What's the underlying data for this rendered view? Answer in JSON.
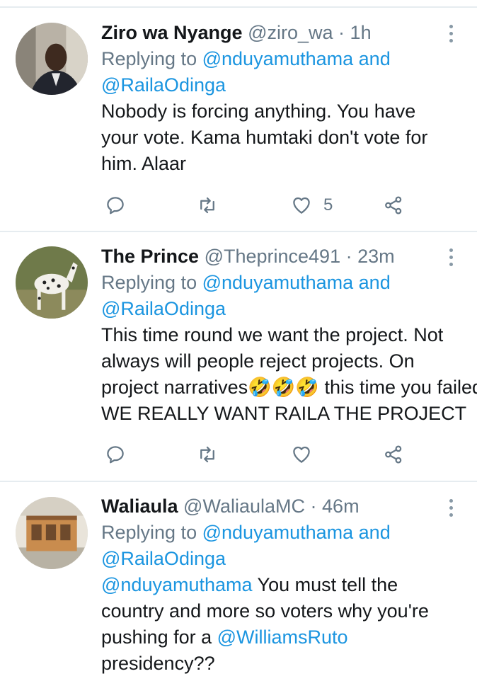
{
  "tweets": [
    {
      "name": "Ziro wa Nyange",
      "handle": "@ziro_wa",
      "dot": "·",
      "time": "1h",
      "replying_prefix": "Replying to",
      "replying_mention_1": "@nduyamuthama",
      "replying_and": "and",
      "replying_mention_2": "@RailaOdinga",
      "body": [
        "Nobody is forcing anything. You have",
        "your vote. Kama humtaki don't vote for",
        "him. Alaar"
      ],
      "like_count": "5"
    },
    {
      "name": "The Prince",
      "handle": "@Theprince491",
      "dot": "·",
      "time": "23m",
      "replying_prefix": "Replying to",
      "replying_mention_1": "@nduyamuthama",
      "replying_and": "and",
      "replying_mention_2": "@RailaOdinga",
      "body": [
        "This time round we want the project. Not",
        "always will people reject projects. On",
        "project narratives🤣🤣🤣 this time you failed.",
        "WE REALLY WANT RAILA THE PROJECT"
      ],
      "like_count": ""
    },
    {
      "name": "Waliaula",
      "handle": "@WaliaulaMC",
      "dot": "·",
      "time": "46m",
      "replying_prefix": "Replying to",
      "replying_mention_1": "@nduyamuthama",
      "replying_and": "and",
      "replying_mention_2": "@RailaOdinga",
      "body_mention_1": "@nduyamuthama",
      "body_1_rest": " You must tell the",
      "body_2": "country and more so voters why you're",
      "body_3_pre": "pushing for a ",
      "body_mention_2": "@WilliamsRuto",
      "body_4": "presidency??",
      "like_count": ""
    }
  ],
  "icons": {
    "reply": "reply-icon",
    "retweet": "retweet-icon",
    "like": "heart-icon",
    "share": "share-icon",
    "more": "more-vertical-icon"
  },
  "colors": {
    "link": "#1b95e0",
    "secondary": "#657786",
    "separator": "#e6ecf0"
  }
}
